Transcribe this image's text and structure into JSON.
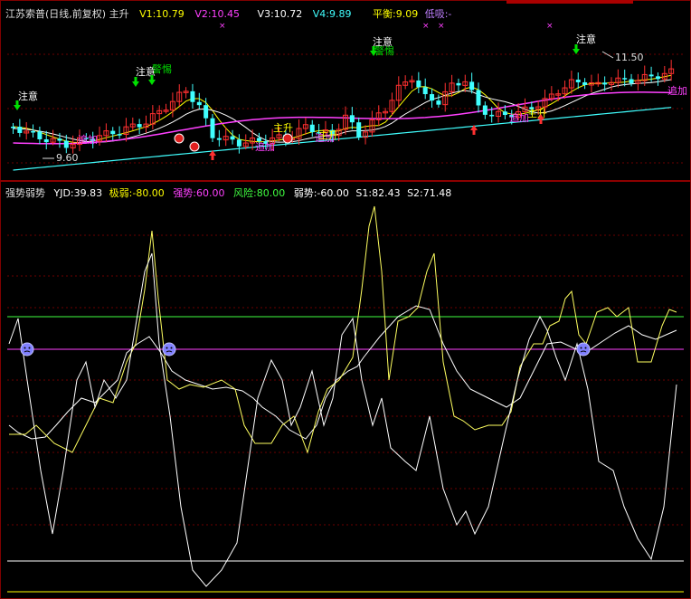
{
  "top_panel": {
    "title": "江苏索普(日线,前复权) 主升",
    "v1": "V1:10.79",
    "v2": "V2:10.45",
    "v3": "V3:10.72",
    "v4": "V4:9.89",
    "balance": "平衡:9.09",
    "low_absorb": "低吸:-",
    "price_high_label": "11.50",
    "price_low_label": "9.60",
    "signal_attention": "注意",
    "signal_alert": "警惕",
    "signal_add": "追加",
    "signal_main": "主升",
    "colors": {
      "v1": "#ffff00",
      "v2": "#ff40ff",
      "v3": "#ffffff",
      "v4": "#40ffff",
      "balance": "#ffff00",
      "low": "#c080ff"
    }
  },
  "bottom_panel": {
    "title": "强势弱势",
    "yjd": "YJD:39.83",
    "extreme_weak": "极弱:-80.00",
    "strong": "强势:60.00",
    "risk": "风险:80.00",
    "weak": "弱势:-60.00",
    "s1": "S1:82.43",
    "s2": "S2:71.48",
    "colors": {
      "extreme_weak": "#ffff00",
      "strong": "#ff40ff",
      "risk": "#40ff40",
      "weak": "#ffffff"
    }
  }
}
